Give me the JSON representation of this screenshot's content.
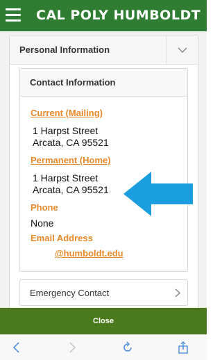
{
  "app": {
    "brand": "CAL POLY HUMBOLDT"
  },
  "section": {
    "title": "Personal Information"
  },
  "contact": {
    "title": "Contact Information",
    "mailing_label": "Current (Mailing)",
    "mailing_line1": "1 Harpst Street",
    "mailing_line2": "Arcata, CA 95521",
    "home_label": "Permanent (Home)",
    "home_line1": "1 Harpst Street",
    "home_line2": "Arcata, CA 95521",
    "phone_label": "Phone",
    "phone_value": "None",
    "email_label": "Email Address",
    "email_value": "@humboldt.edu"
  },
  "emergency": {
    "label": "Emergency Contact"
  },
  "footer": {
    "close_label": "Close"
  },
  "colors": {
    "brand_green": "#2e7d32",
    "close_green": "#4a7a1a",
    "link_orange": "#e8892b",
    "arrow_blue": "#1a9ee0"
  },
  "icons": {
    "menu": "hamburger-icon",
    "collapse": "chevron-down-icon",
    "annotation": "arrow-left-icon",
    "emergency": "chevron-right-icon",
    "back": "chevron-left-icon",
    "forward": "chevron-right-icon",
    "reload": "refresh-icon",
    "share": "share-icon"
  }
}
